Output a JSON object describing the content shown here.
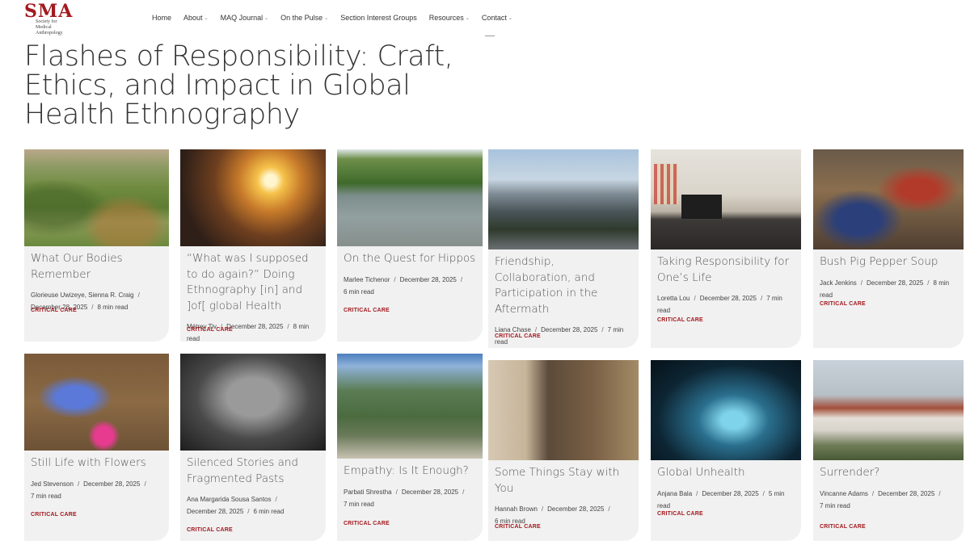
{
  "header": {
    "logo_mark": "SMA",
    "logo_sub_line1": "Society for Medical",
    "logo_sub_line2": "Anthropology",
    "nav": [
      {
        "label": "Home",
        "has_dropdown": false
      },
      {
        "label": "About",
        "has_dropdown": true
      },
      {
        "label": "MAQ Journal",
        "has_dropdown": true
      },
      {
        "label": "On the Pulse",
        "has_dropdown": true
      },
      {
        "label": "Section Interest Groups",
        "has_dropdown": false
      },
      {
        "label": "Resources",
        "has_dropdown": true
      },
      {
        "label": "Contact",
        "has_dropdown": true
      }
    ]
  },
  "page_title": "Flashes of Responsibility: Craft, Ethics, and Impact in Global Health Ethnography",
  "colors": {
    "accent": "#a3191f",
    "card_bg": "#f1f1f1",
    "text": "#333333"
  },
  "cards": [
    {
      "title": "What Our Bodies Remember",
      "authors": "Glorieuse Uwizeye, Sienna R. Craig",
      "date": "December 28, 2025",
      "read": "8 min read",
      "tag": "CRITICAL CARE"
    },
    {
      "title": "“What was I supposed to do again?” Doing Ethnography [in] and ]of[ global Health",
      "authors": "Métrey Tiv",
      "date": "December 28, 2025",
      "read": "8 min read",
      "tag": "CRITICAL CARE"
    },
    {
      "title": "On the Quest for Hippos",
      "authors": "Marlee Tichenor",
      "date": "December 28, 2025",
      "read": "6 min read",
      "tag": "CRITICAL CARE"
    },
    {
      "title": "Friendship, Collaboration, and Participation in the Aftermath",
      "authors": "Liana Chase",
      "date": "December 28, 2025",
      "read": "7 min read",
      "tag": "CRITICAL CARE"
    },
    {
      "title": "Taking Responsibility for One’s Life",
      "authors": "Loretta Lou",
      "date": "December 28, 2025",
      "read": "7 min read",
      "tag": "CRITICAL CARE"
    },
    {
      "title": "Bush Pig Pepper Soup",
      "authors": "Jack Jenkins",
      "date": "December 28, 2025",
      "read": "8 min read",
      "tag": "CRITICAL CARE"
    },
    {
      "title": "Still Life with Flowers",
      "authors": "Jed Stevenson",
      "date": "December 28, 2025",
      "read": "7 min read",
      "tag": "CRITICAL CARE"
    },
    {
      "title": "Silenced Stories and Fragmented Pasts",
      "authors": "Ana Margarida Sousa Santos",
      "date": "December 28, 2025",
      "read": "6 min read",
      "tag": "CRITICAL CARE"
    },
    {
      "title": "Empathy: Is It Enough?",
      "authors": "Parbati Shrestha",
      "date": "December 28, 2025",
      "read": "7 min read",
      "tag": "CRITICAL CARE"
    },
    {
      "title": "Some Things Stay with You",
      "authors": "Hannah Brown",
      "date": "December 28, 2025",
      "read": "6 min read",
      "tag": "CRITICAL CARE"
    },
    {
      "title": "Global Unhealth",
      "authors": "Anjana Bala",
      "date": "December 28, 2025",
      "read": "5 min read",
      "tag": "CRITICAL CARE"
    },
    {
      "title": "Surrender?",
      "authors": "Vincanne Adams",
      "date": "December 28, 2025",
      "read": "7 min read",
      "tag": "CRITICAL CARE"
    }
  ]
}
